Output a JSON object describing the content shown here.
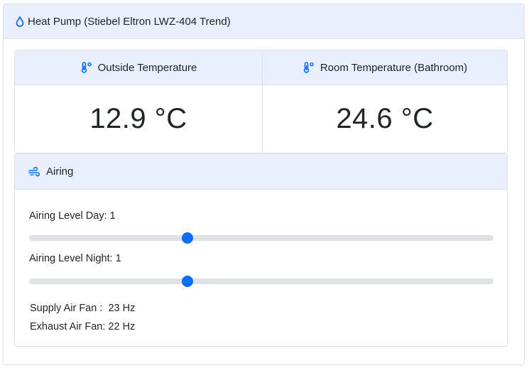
{
  "header": {
    "title": "Heat Pump (Stiebel Eltron LWZ-404 Trend)",
    "icon": "droplet-icon"
  },
  "temperatures": [
    {
      "label": "Outside Temperature",
      "value": "12.9 °C",
      "icon": "thermometer-icon"
    },
    {
      "label": "Room Temperature (Bathroom)",
      "value": "24.6 °C",
      "icon": "thermometer-icon"
    }
  ],
  "airing": {
    "title": "Airing",
    "icon": "wind-icon",
    "day": {
      "label": "Airing Level Day: 1",
      "value": 1,
      "fraction": 0.337
    },
    "night": {
      "label": "Airing Level Night: 1",
      "value": 1,
      "fraction": 0.337
    },
    "supply_fan": {
      "label": "Supply Air Fan",
      "sep": ":",
      "value": "23 Hz"
    },
    "exhaust_fan": {
      "label": "Exhaust Air Fan:",
      "value": "22 Hz"
    }
  },
  "colors": {
    "accent": "#0d6efd",
    "header_bg": "#e9effd",
    "track": "#dee2e6"
  }
}
